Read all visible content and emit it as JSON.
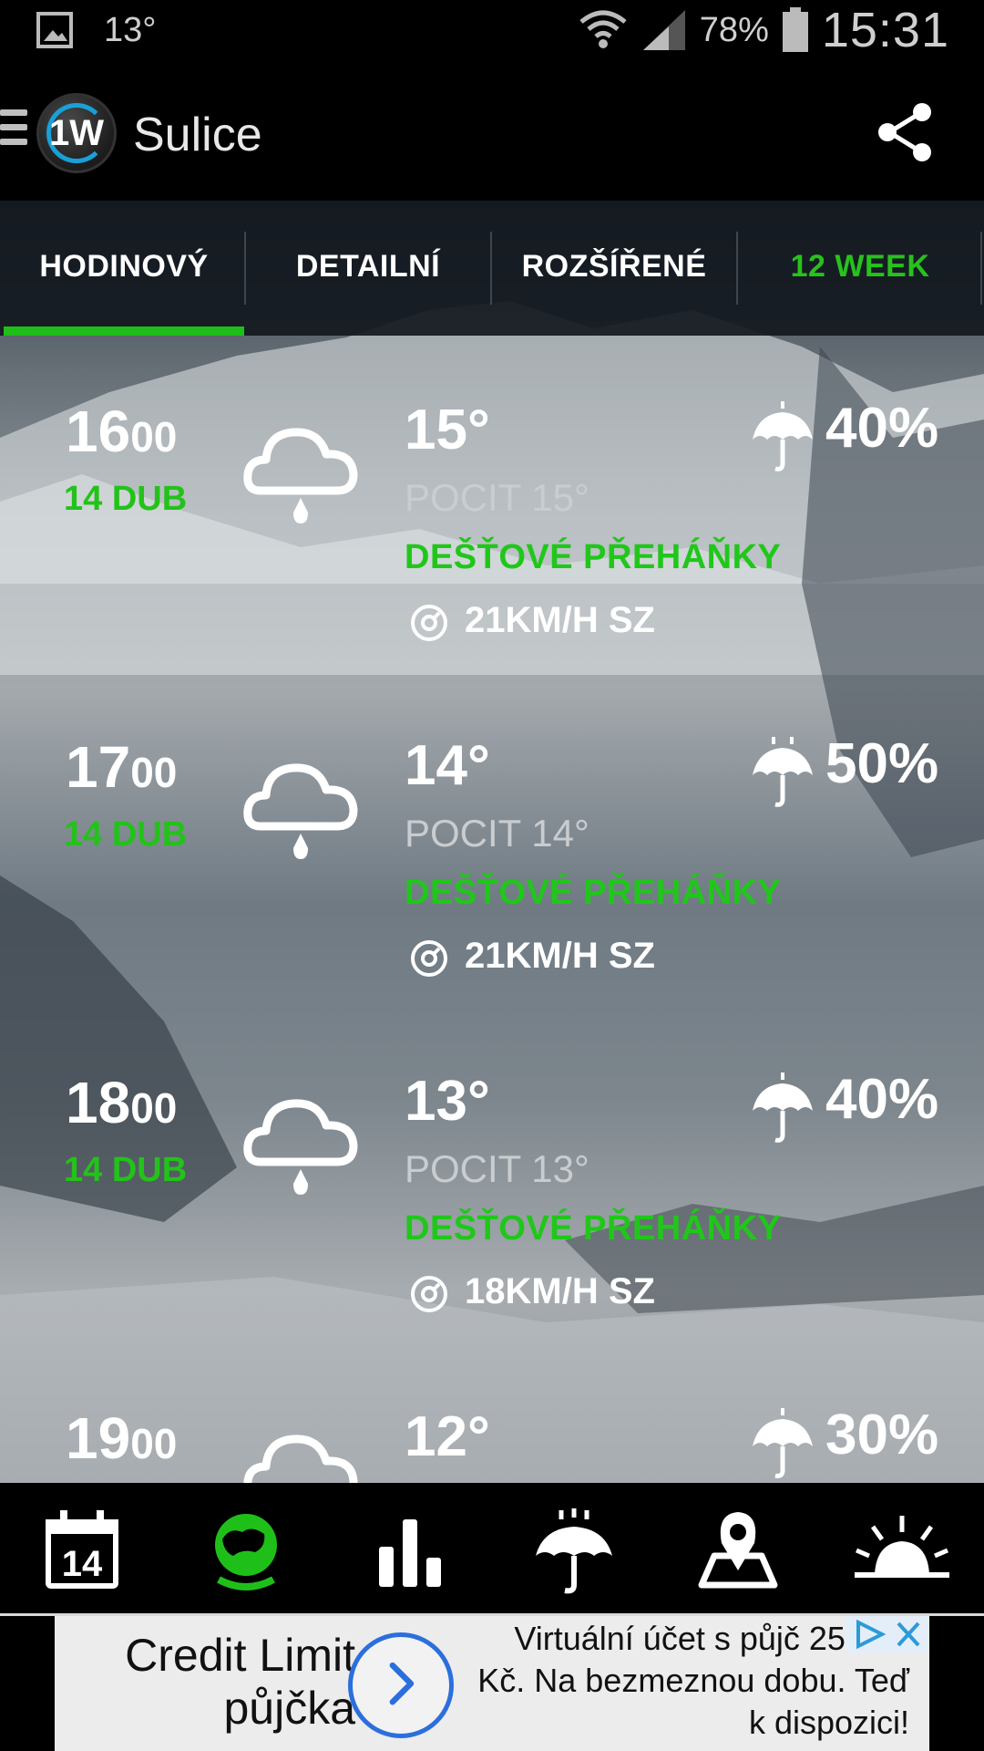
{
  "status_bar": {
    "temperature": "13°",
    "battery": "78%",
    "time": "15:31"
  },
  "app_bar": {
    "logo_text": "1W",
    "city": "Sulice"
  },
  "tabs": [
    {
      "label": "HODINOVÝ"
    },
    {
      "label": "DETAILNÍ"
    },
    {
      "label": "ROZŠÍŘENÉ"
    },
    {
      "label": "12 WEEK"
    }
  ],
  "forecast": [
    {
      "hour": "16",
      "minutes": "00",
      "date": "14 DUB",
      "temp": "15°",
      "feel": "POCIT 15°",
      "desc": "DEŠŤOVÉ PŘEHÁŇKY",
      "wind": "21KM/H SZ",
      "rain_pct": "40%"
    },
    {
      "hour": "17",
      "minutes": "00",
      "date": "14 DUB",
      "temp": "14°",
      "feel": "POCIT 14°",
      "desc": "DEŠŤOVÉ PŘEHÁŇKY",
      "wind": "21KM/H SZ",
      "rain_pct": "50%"
    },
    {
      "hour": "18",
      "minutes": "00",
      "date": "14 DUB",
      "temp": "13°",
      "feel": "POCIT 13°",
      "desc": "DEŠŤOVÉ PŘEHÁŇKY",
      "wind": "18KM/H SZ",
      "rain_pct": "40%"
    },
    {
      "hour": "19",
      "minutes": "00",
      "temp": "12°",
      "rain_pct": "30%"
    }
  ],
  "bottom_nav": {
    "calendar_day": "14",
    "items": [
      "calendar-icon",
      "globe-icon",
      "bar-chart-icon",
      "umbrella-icon",
      "map-pin-icon",
      "sunrise-icon"
    ],
    "active_color": "#1fbf1a"
  },
  "ad": {
    "title": "Credit Limit půjčka",
    "body": "Virtuální účet s půjč 25.000 Kč. Na bezmeznou dobu. Teď k dispozici!"
  },
  "colors": {
    "accent_green": "#20c71a",
    "background": "#000000"
  }
}
